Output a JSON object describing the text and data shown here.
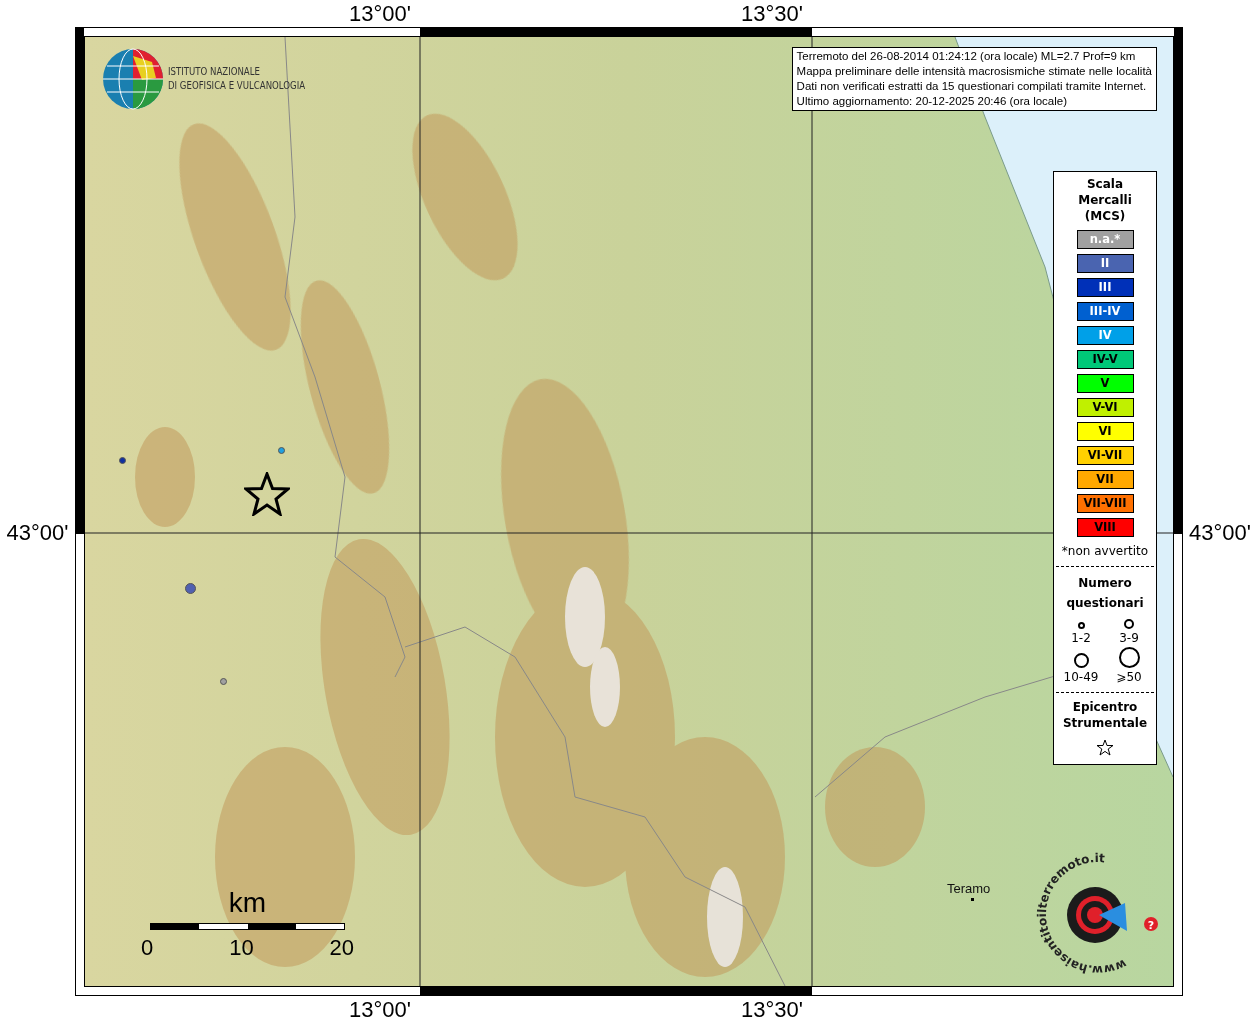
{
  "axes": {
    "top": [
      "13°00'",
      "13°30'"
    ],
    "bottom": [
      "13°00'",
      "13°30'"
    ],
    "left": "43°00'",
    "right": "43°00'"
  },
  "logo": {
    "lines": [
      "ISTITUTO NAZIONALE",
      "DI GEOFISICA E VULCANOLOGIA"
    ]
  },
  "info": [
    "Terremoto del 26-08-2014 01:24:12 (ora locale) ML=2.7 Prof=9 km",
    "Mappa preliminare delle intensità macrosismiche stimate nelle località",
    "Dati non verificati estratti da 15 questionari compilati tramite Internet.",
    "Ultimo aggiornamento: 20-12-2025 20:46 (ora locale)"
  ],
  "legend": {
    "title": [
      "Scala",
      "Mercalli",
      "(MCS)"
    ],
    "classes": [
      {
        "label": "n.a.*",
        "color": "#a0a0a0",
        "dark_label": false
      },
      {
        "label": "II",
        "color": "#4a64b0",
        "dark_label": false
      },
      {
        "label": "III",
        "color": "#0030b8",
        "dark_label": false
      },
      {
        "label": "III-IV",
        "color": "#0060d0",
        "dark_label": false
      },
      {
        "label": "IV",
        "color": "#00a0e8",
        "dark_label": false
      },
      {
        "label": "IV-V",
        "color": "#00c878",
        "dark_label": true
      },
      {
        "label": "V",
        "color": "#00ff00",
        "dark_label": true
      },
      {
        "label": "V-VI",
        "color": "#c0f000",
        "dark_label": true
      },
      {
        "label": "VI",
        "color": "#ffff00",
        "dark_label": true
      },
      {
        "label": "VI-VII",
        "color": "#ffd000",
        "dark_label": true
      },
      {
        "label": "VII",
        "color": "#ffa800",
        "dark_label": true
      },
      {
        "label": "VII-VIII",
        "color": "#ff7000",
        "dark_label": true
      },
      {
        "label": "VIII",
        "color": "#ff0000",
        "dark_label": true
      }
    ],
    "footnote": "*non avvertito",
    "count_title": [
      "Numero",
      "questionari"
    ],
    "counts": [
      {
        "label": "1-2",
        "kind": "xs"
      },
      {
        "label": "3-9",
        "kind": "s"
      },
      {
        "label": "10-49",
        "kind": "m"
      },
      {
        "label": "⩾50",
        "kind": "l"
      }
    ],
    "epicenter_title": [
      "Epicentro",
      "Strumentale"
    ]
  },
  "points": [
    {
      "color": "#1030a0",
      "kind": "xs"
    },
    {
      "color": "#20a0e0",
      "kind": "xs"
    },
    {
      "color": "#5060b0",
      "kind": "s"
    },
    {
      "color": "#a0a0a0",
      "kind": "xs"
    }
  ],
  "places": [
    {
      "name": "Teramo"
    }
  ],
  "scale": {
    "unit": "km",
    "ticks": [
      "0",
      "10",
      "20"
    ]
  },
  "site_logo": {
    "text": "www.haisentitoilterremoto.it",
    "badge": "?"
  }
}
